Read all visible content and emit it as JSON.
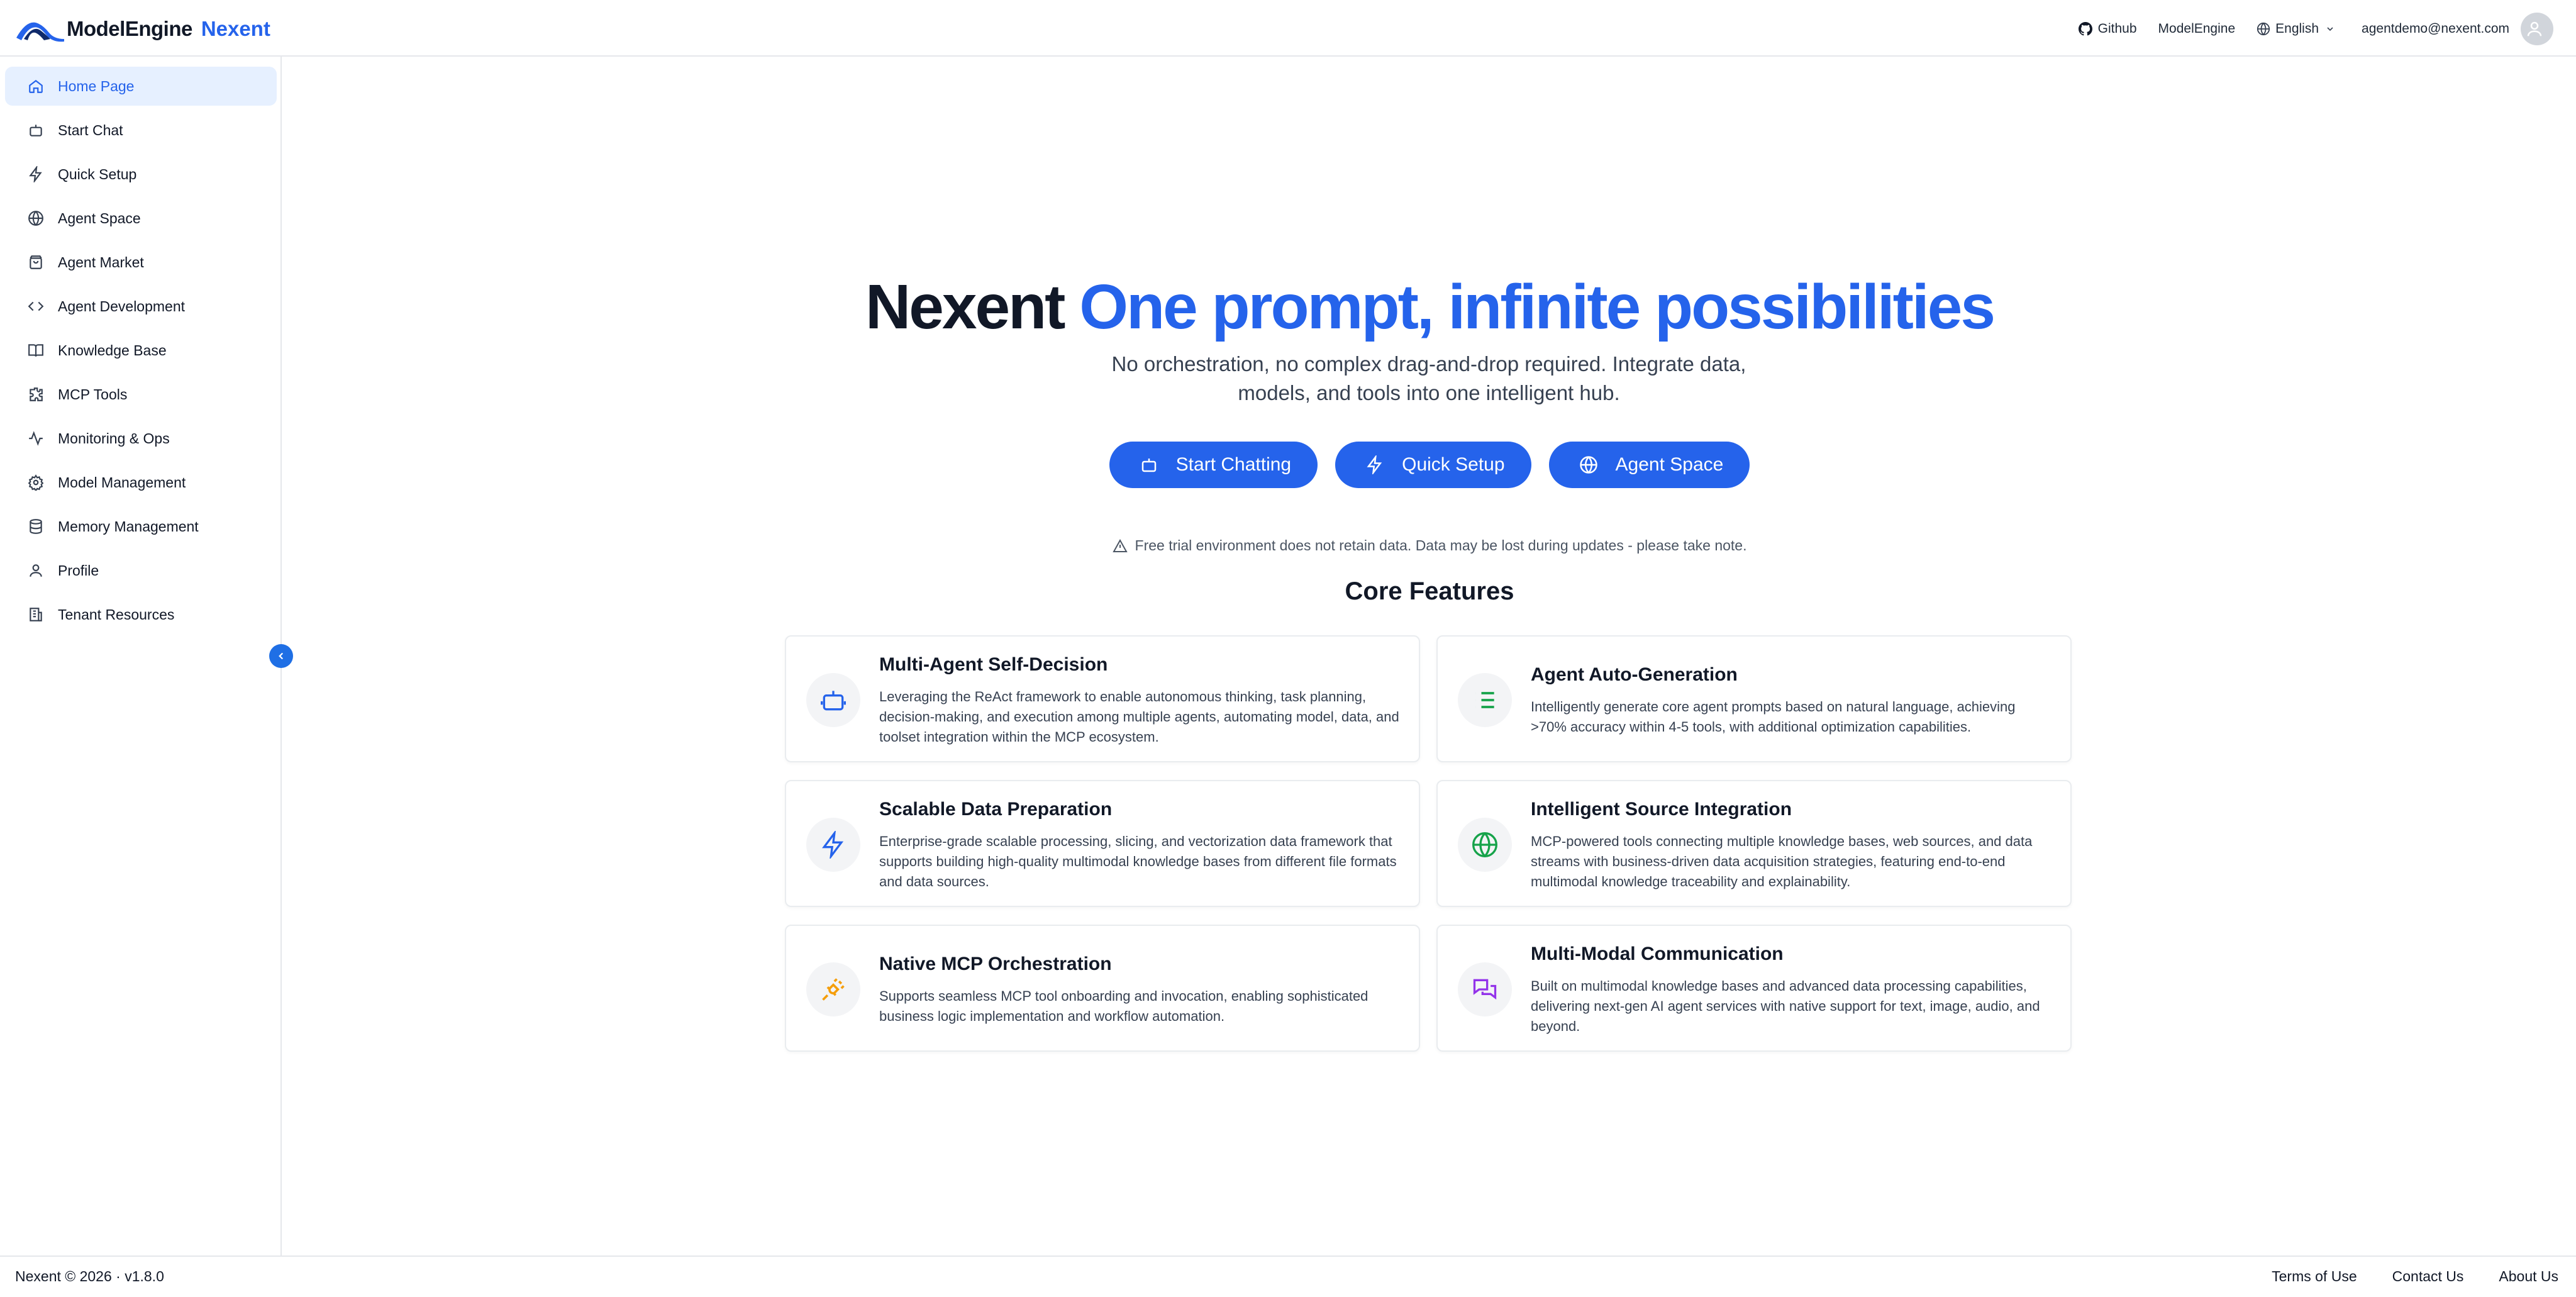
{
  "header": {
    "logo_text": "ModelEngine",
    "brand": "Nexent",
    "github_label": "Github",
    "modelengine_label": "ModelEngine",
    "language_label": "English",
    "user_email": "agentdemo@nexent.com"
  },
  "sidebar": {
    "items": [
      {
        "label": "Home Page",
        "icon": "home-icon",
        "active": true
      },
      {
        "label": "Start Chat",
        "icon": "robot-icon"
      },
      {
        "label": "Quick Setup",
        "icon": "lightning-icon"
      },
      {
        "label": "Agent Space",
        "icon": "globe-icon"
      },
      {
        "label": "Agent Market",
        "icon": "shopping-bag-icon"
      },
      {
        "label": "Agent Development",
        "icon": "code-icon"
      },
      {
        "label": "Knowledge Base",
        "icon": "book-icon"
      },
      {
        "label": "MCP Tools",
        "icon": "puzzle-icon"
      },
      {
        "label": "Monitoring & Ops",
        "icon": "activity-icon"
      },
      {
        "label": "Model Management",
        "icon": "settings-icon"
      },
      {
        "label": "Memory Management",
        "icon": "database-icon"
      },
      {
        "label": "Profile",
        "icon": "user-icon"
      },
      {
        "label": "Tenant Resources",
        "icon": "building-icon"
      }
    ]
  },
  "hero": {
    "title_brand": "Nexent",
    "title_tagline": "One prompt, infinite possibilities",
    "subtitle": "No orchestration, no complex drag-and-drop required. Integrate data, models, and tools into one intelligent hub.",
    "buttons": {
      "start_chatting": "Start Chatting",
      "quick_setup": "Quick Setup",
      "agent_space": "Agent Space"
    },
    "notice": "Free trial environment does not retain data. Data may be lost during updates - please take note."
  },
  "features": {
    "title": "Core Features",
    "items": [
      {
        "title": "Multi-Agent Self-Decision",
        "desc": "Leveraging the ReAct framework to enable autonomous thinking, task planning, decision-making, and execution among multiple agents, automating model, data, and toolset integration within the MCP ecosystem.",
        "icon": "robot-icon",
        "color": "#2563eb"
      },
      {
        "title": "Agent Auto-Generation",
        "desc": "Intelligently generate core agent prompts based on natural language, achieving >70% accuracy within 4-5 tools, with additional optimization capabilities.",
        "icon": "list-icon",
        "color": "#16a34a"
      },
      {
        "title": "Scalable Data Preparation",
        "desc": "Enterprise-grade scalable processing, slicing, and vectorization data framework that supports building high-quality multimodal knowledge bases from different file formats and data sources.",
        "icon": "lightning-icon",
        "color": "#2563eb"
      },
      {
        "title": "Intelligent Source Integration",
        "desc": "MCP-powered tools connecting multiple knowledge bases, web sources, and data streams with business-driven data acquisition strategies, featuring end-to-end multimodal knowledge traceability and explainability.",
        "icon": "globe-icon",
        "color": "#16a34a"
      },
      {
        "title": "Native MCP Orchestration",
        "desc": "Supports seamless MCP tool onboarding and invocation, enabling sophisticated business logic implementation and workflow automation.",
        "icon": "plug-icon",
        "color": "#f59e0b"
      },
      {
        "title": "Multi-Modal Communication",
        "desc": "Built on multimodal knowledge bases and advanced data processing capabilities, delivering next-gen AI agent services with native support for text, image, audio, and beyond.",
        "icon": "chat-bubbles-icon",
        "color": "#9333ea"
      }
    ]
  },
  "footer": {
    "copyright": "Nexent © 2026 · v1.8.0",
    "terms": "Terms of Use",
    "contact": "Contact Us",
    "about": "About Us"
  }
}
